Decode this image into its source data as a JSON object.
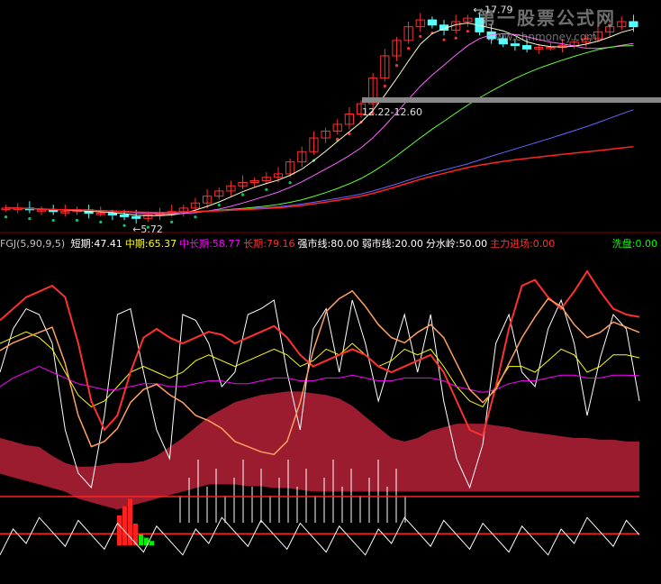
{
  "watermark": {
    "title": "第一股票公式网",
    "url": "www.chnmoney.com"
  },
  "indicator": {
    "name": "FGJ(5,90,9,5)",
    "items": [
      {
        "label": "短期:",
        "value": "47.41",
        "color": "#ffffff"
      },
      {
        "label": "中期:",
        "value": "65.37",
        "color": "#ffff00"
      },
      {
        "label": "中长期:",
        "value": "58.77",
        "color": "#ff00ff"
      },
      {
        "label": "长期:",
        "value": "79.16",
        "color": "#ff3030"
      },
      {
        "label": "强市线:",
        "value": "80.00",
        "color": "#ffffff"
      },
      {
        "label": "弱市线:",
        "value": "20.00",
        "color": "#ffffff"
      },
      {
        "label": "分水岭:",
        "value": "50.00",
        "color": "#ffffff"
      },
      {
        "label": "主力进场:",
        "value": "0.00",
        "color": "#ff3030"
      }
    ],
    "wash": {
      "label": "洗盘:",
      "value": "0.00",
      "color": "#00ff00"
    }
  },
  "chart_data": [
    {
      "type": "candlestick",
      "annotations": {
        "high": "17.79",
        "low": "5.72",
        "range": "12.22-12.60"
      },
      "price_series": [
        6.3,
        6.3,
        6.2,
        6.2,
        6.1,
        6.1,
        6.2,
        6.0,
        6.0,
        5.9,
        5.8,
        5.7,
        5.9,
        6.0,
        6.1,
        6.3,
        6.6,
        7.0,
        7.3,
        7.6,
        7.8,
        7.9,
        8.1,
        8.3,
        9.0,
        9.6,
        10.4,
        10.8,
        11.2,
        11.8,
        12.4,
        13.9,
        15.2,
        16.1,
        16.9,
        17.3,
        17.0,
        16.7,
        17.2,
        17.4,
        16.6,
        16.2,
        15.9,
        15.8,
        15.6,
        15.7,
        15.7,
        15.8,
        16.0,
        16.2,
        16.6,
        16.9,
        17.2,
        16.9
      ],
      "ma_colors": [
        "#ffffcc",
        "#ff66ff",
        "#66ff33",
        "#6666ff",
        "#ff2222"
      ]
    },
    {
      "type": "line",
      "ylim": [
        0,
        100
      ],
      "reference_lines": {
        "strong": 80,
        "weak": 20,
        "divide": 50
      },
      "series": [
        {
          "name": "短期",
          "color": "#ffffff",
          "values": [
            60,
            75,
            82,
            80,
            70,
            40,
            25,
            20,
            45,
            80,
            82,
            60,
            40,
            30,
            80,
            78,
            70,
            55,
            60,
            80,
            82,
            85,
            60,
            40,
            75,
            82,
            60,
            85,
            70,
            50,
            65,
            80,
            60,
            80,
            50,
            30,
            20,
            35,
            70,
            80,
            60,
            55,
            75,
            85,
            70,
            45,
            65,
            80,
            75,
            50
          ]
        },
        {
          "name": "中期",
          "color": "#ffff00",
          "values": [
            70,
            72,
            74,
            72,
            68,
            60,
            52,
            48,
            50,
            55,
            60,
            62,
            60,
            58,
            60,
            64,
            66,
            64,
            62,
            64,
            66,
            68,
            66,
            62,
            64,
            68,
            66,
            70,
            66,
            62,
            64,
            68,
            66,
            68,
            62,
            55,
            50,
            48,
            55,
            62,
            62,
            60,
            64,
            68,
            66,
            60,
            62,
            66,
            66,
            65
          ]
        },
        {
          "name": "中长期",
          "color": "#ff00ff",
          "values": [
            55,
            58,
            60,
            62,
            60,
            58,
            56,
            55,
            54,
            54,
            55,
            56,
            56,
            55,
            55,
            56,
            57,
            57,
            56,
            56,
            57,
            58,
            58,
            57,
            57,
            58,
            58,
            59,
            58,
            57,
            57,
            58,
            58,
            58,
            57,
            55,
            54,
            53,
            54,
            56,
            57,
            57,
            58,
            59,
            59,
            58,
            58,
            59,
            59,
            58.77
          ]
        },
        {
          "name": "长期",
          "color": "#ff3030",
          "values": [
            78,
            82,
            86,
            88,
            90,
            86,
            70,
            50,
            40,
            45,
            60,
            72,
            75,
            72,
            70,
            72,
            74,
            73,
            70,
            72,
            74,
            76,
            72,
            66,
            62,
            64,
            66,
            68,
            66,
            62,
            60,
            62,
            64,
            66,
            60,
            50,
            40,
            38,
            55,
            75,
            90,
            92,
            86,
            82,
            88,
            95,
            88,
            82,
            80,
            79.16
          ]
        }
      ]
    }
  ]
}
